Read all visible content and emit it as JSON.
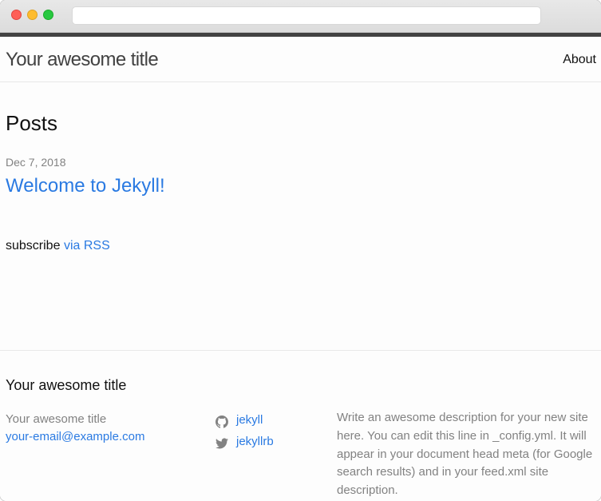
{
  "browser": {
    "url": ""
  },
  "header": {
    "site_title": "Your awesome title",
    "nav": [
      {
        "label": "About"
      }
    ]
  },
  "main": {
    "heading": "Posts",
    "posts": [
      {
        "date": "Dec 7, 2018",
        "title": "Welcome to Jekyll!"
      }
    ],
    "subscribe_text": "subscribe",
    "subscribe_link": "via RSS"
  },
  "footer": {
    "heading": "Your awesome title",
    "site_name": "Your awesome title",
    "email": "your-email@example.com",
    "social": [
      {
        "icon": "github-icon",
        "label": "jekyll"
      },
      {
        "icon": "twitter-icon",
        "label": "jekyllrb"
      }
    ],
    "description": "Write an awesome description for your new site here. You can edit this line in _config.yml. It will appear in your document head meta (for Google search results) and in your feed.xml site description."
  },
  "colors": {
    "link": "#2a7ae2",
    "text": "#111111",
    "muted": "#828282",
    "topbar": "#424242"
  }
}
